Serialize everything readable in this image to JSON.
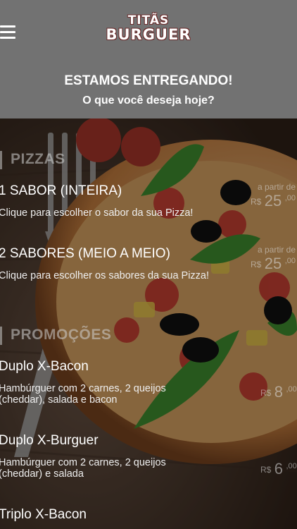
{
  "header": {
    "logo_line1": "TITÃS",
    "logo_line2": "BURGUER",
    "title": "ESTAMOS ENTREGANDO!",
    "subtitle": "O que você deseja hoje?"
  },
  "sections": {
    "pizzas": {
      "title": "PIZZAS",
      "items": [
        {
          "name": "1 SABOR (INTEIRA)",
          "desc": "Clique para escolher o sabor da sua Pizza!",
          "from": "a partir de",
          "currency": "R$",
          "price": "25",
          "cents": ",00"
        },
        {
          "name": "2 SABORES (MEIO A MEIO)",
          "desc": "Clique para escolher os sabores da sua Pizza!",
          "from": "a partir de",
          "currency": "R$",
          "price": "25",
          "cents": ",00"
        }
      ]
    },
    "promocoes": {
      "title": "PROMOÇÕES",
      "items": [
        {
          "name": "Duplo X-Bacon",
          "desc": "Hambúrguer com 2 carnes, 2 queijos (cheddar), salada e bacon",
          "currency": "R$",
          "price": "8",
          "cents": ",00"
        },
        {
          "name": "Duplo X-Burguer",
          "desc": "Hambúrguer com 2 carnes, 2 queijos (cheddar) e salada",
          "currency": "R$",
          "price": "6",
          "cents": ",00"
        },
        {
          "name": "Triplo X-Bacon"
        }
      ]
    }
  },
  "icons": {
    "menu": "hamburger-menu-icon"
  },
  "colors": {
    "header_bg": "#727272",
    "text": "#ffffff",
    "muted": "#b9b9b9"
  }
}
